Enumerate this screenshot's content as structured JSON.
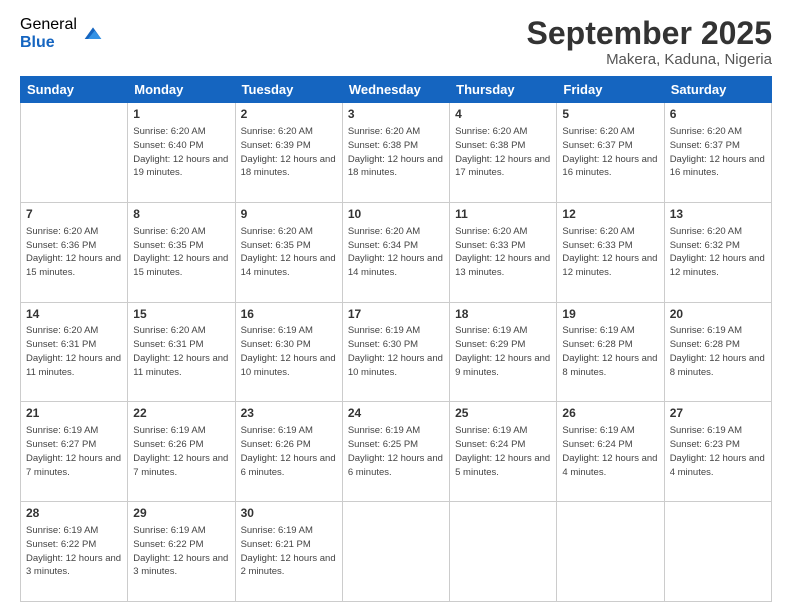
{
  "logo": {
    "general": "General",
    "blue": "Blue"
  },
  "header": {
    "month": "September 2025",
    "location": "Makera, Kaduna, Nigeria"
  },
  "weekdays": [
    "Sunday",
    "Monday",
    "Tuesday",
    "Wednesday",
    "Thursday",
    "Friday",
    "Saturday"
  ],
  "weeks": [
    [
      {
        "day": "",
        "sunrise": "",
        "sunset": "",
        "daylight": ""
      },
      {
        "day": "1",
        "sunrise": "Sunrise: 6:20 AM",
        "sunset": "Sunset: 6:40 PM",
        "daylight": "Daylight: 12 hours and 19 minutes."
      },
      {
        "day": "2",
        "sunrise": "Sunrise: 6:20 AM",
        "sunset": "Sunset: 6:39 PM",
        "daylight": "Daylight: 12 hours and 18 minutes."
      },
      {
        "day": "3",
        "sunrise": "Sunrise: 6:20 AM",
        "sunset": "Sunset: 6:38 PM",
        "daylight": "Daylight: 12 hours and 18 minutes."
      },
      {
        "day": "4",
        "sunrise": "Sunrise: 6:20 AM",
        "sunset": "Sunset: 6:38 PM",
        "daylight": "Daylight: 12 hours and 17 minutes."
      },
      {
        "day": "5",
        "sunrise": "Sunrise: 6:20 AM",
        "sunset": "Sunset: 6:37 PM",
        "daylight": "Daylight: 12 hours and 16 minutes."
      },
      {
        "day": "6",
        "sunrise": "Sunrise: 6:20 AM",
        "sunset": "Sunset: 6:37 PM",
        "daylight": "Daylight: 12 hours and 16 minutes."
      }
    ],
    [
      {
        "day": "7",
        "sunrise": "Sunrise: 6:20 AM",
        "sunset": "Sunset: 6:36 PM",
        "daylight": "Daylight: 12 hours and 15 minutes."
      },
      {
        "day": "8",
        "sunrise": "Sunrise: 6:20 AM",
        "sunset": "Sunset: 6:35 PM",
        "daylight": "Daylight: 12 hours and 15 minutes."
      },
      {
        "day": "9",
        "sunrise": "Sunrise: 6:20 AM",
        "sunset": "Sunset: 6:35 PM",
        "daylight": "Daylight: 12 hours and 14 minutes."
      },
      {
        "day": "10",
        "sunrise": "Sunrise: 6:20 AM",
        "sunset": "Sunset: 6:34 PM",
        "daylight": "Daylight: 12 hours and 14 minutes."
      },
      {
        "day": "11",
        "sunrise": "Sunrise: 6:20 AM",
        "sunset": "Sunset: 6:33 PM",
        "daylight": "Daylight: 12 hours and 13 minutes."
      },
      {
        "day": "12",
        "sunrise": "Sunrise: 6:20 AM",
        "sunset": "Sunset: 6:33 PM",
        "daylight": "Daylight: 12 hours and 12 minutes."
      },
      {
        "day": "13",
        "sunrise": "Sunrise: 6:20 AM",
        "sunset": "Sunset: 6:32 PM",
        "daylight": "Daylight: 12 hours and 12 minutes."
      }
    ],
    [
      {
        "day": "14",
        "sunrise": "Sunrise: 6:20 AM",
        "sunset": "Sunset: 6:31 PM",
        "daylight": "Daylight: 12 hours and 11 minutes."
      },
      {
        "day": "15",
        "sunrise": "Sunrise: 6:20 AM",
        "sunset": "Sunset: 6:31 PM",
        "daylight": "Daylight: 12 hours and 11 minutes."
      },
      {
        "day": "16",
        "sunrise": "Sunrise: 6:19 AM",
        "sunset": "Sunset: 6:30 PM",
        "daylight": "Daylight: 12 hours and 10 minutes."
      },
      {
        "day": "17",
        "sunrise": "Sunrise: 6:19 AM",
        "sunset": "Sunset: 6:30 PM",
        "daylight": "Daylight: 12 hours and 10 minutes."
      },
      {
        "day": "18",
        "sunrise": "Sunrise: 6:19 AM",
        "sunset": "Sunset: 6:29 PM",
        "daylight": "Daylight: 12 hours and 9 minutes."
      },
      {
        "day": "19",
        "sunrise": "Sunrise: 6:19 AM",
        "sunset": "Sunset: 6:28 PM",
        "daylight": "Daylight: 12 hours and 8 minutes."
      },
      {
        "day": "20",
        "sunrise": "Sunrise: 6:19 AM",
        "sunset": "Sunset: 6:28 PM",
        "daylight": "Daylight: 12 hours and 8 minutes."
      }
    ],
    [
      {
        "day": "21",
        "sunrise": "Sunrise: 6:19 AM",
        "sunset": "Sunset: 6:27 PM",
        "daylight": "Daylight: 12 hours and 7 minutes."
      },
      {
        "day": "22",
        "sunrise": "Sunrise: 6:19 AM",
        "sunset": "Sunset: 6:26 PM",
        "daylight": "Daylight: 12 hours and 7 minutes."
      },
      {
        "day": "23",
        "sunrise": "Sunrise: 6:19 AM",
        "sunset": "Sunset: 6:26 PM",
        "daylight": "Daylight: 12 hours and 6 minutes."
      },
      {
        "day": "24",
        "sunrise": "Sunrise: 6:19 AM",
        "sunset": "Sunset: 6:25 PM",
        "daylight": "Daylight: 12 hours and 6 minutes."
      },
      {
        "day": "25",
        "sunrise": "Sunrise: 6:19 AM",
        "sunset": "Sunset: 6:24 PM",
        "daylight": "Daylight: 12 hours and 5 minutes."
      },
      {
        "day": "26",
        "sunrise": "Sunrise: 6:19 AM",
        "sunset": "Sunset: 6:24 PM",
        "daylight": "Daylight: 12 hours and 4 minutes."
      },
      {
        "day": "27",
        "sunrise": "Sunrise: 6:19 AM",
        "sunset": "Sunset: 6:23 PM",
        "daylight": "Daylight: 12 hours and 4 minutes."
      }
    ],
    [
      {
        "day": "28",
        "sunrise": "Sunrise: 6:19 AM",
        "sunset": "Sunset: 6:22 PM",
        "daylight": "Daylight: 12 hours and 3 minutes."
      },
      {
        "day": "29",
        "sunrise": "Sunrise: 6:19 AM",
        "sunset": "Sunset: 6:22 PM",
        "daylight": "Daylight: 12 hours and 3 minutes."
      },
      {
        "day": "30",
        "sunrise": "Sunrise: 6:19 AM",
        "sunset": "Sunset: 6:21 PM",
        "daylight": "Daylight: 12 hours and 2 minutes."
      },
      {
        "day": "",
        "sunrise": "",
        "sunset": "",
        "daylight": ""
      },
      {
        "day": "",
        "sunrise": "",
        "sunset": "",
        "daylight": ""
      },
      {
        "day": "",
        "sunrise": "",
        "sunset": "",
        "daylight": ""
      },
      {
        "day": "",
        "sunrise": "",
        "sunset": "",
        "daylight": ""
      }
    ]
  ]
}
